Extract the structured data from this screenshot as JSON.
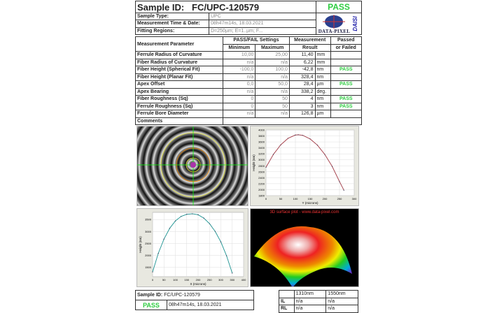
{
  "header": {
    "sample_id_label": "Sample ID:",
    "sample_id": "FC/UPC-120579",
    "status": "PASS",
    "rows": [
      {
        "label": "Sample Type:",
        "value": "UPC"
      },
      {
        "label": "Measurement Time & Date:",
        "value": "08h47m14s, 18.03.2021"
      },
      {
        "label": "Fitting Regions:",
        "value": "D=250µm; E=1..µm; F..."
      }
    ],
    "logo_text": "DATA-PIXEL",
    "logo_brand": "DAISI"
  },
  "table": {
    "col_param": "Measurement Parameter",
    "col_settings": "PASS/FAIL Settings",
    "col_min": "Minimum",
    "col_max": "Maximum",
    "col_result": "Measurement",
    "col_result2": "Result",
    "col_pf": "Passed",
    "col_pf2": "or Failed",
    "rows": [
      {
        "name": "Ferrule Radius of Curvature",
        "min": "10,00",
        "max": "25,00",
        "value": "11,40",
        "unit": "mm",
        "status": ""
      },
      {
        "name": "Fiber Radius of Curvature",
        "min": "n/a",
        "max": "n/a",
        "value": "6,22",
        "unit": "mm",
        "status": ""
      },
      {
        "name": "Fiber Height (Spherical Fit)",
        "min": "-100,0",
        "max": "100,0",
        "value": "-42,8",
        "unit": "nm",
        "status": "PASS"
      },
      {
        "name": "Fiber Height (Planar Fit)",
        "min": "n/a",
        "max": "n/a",
        "value": "328,4",
        "unit": "nm",
        "status": ""
      },
      {
        "name": "Apex Offset",
        "min": "0,0",
        "max": "50,0",
        "value": "28,4",
        "unit": "µm",
        "status": "PASS"
      },
      {
        "name": "Apex Bearing",
        "min": "n/a",
        "max": "n/a",
        "value": "338,2",
        "unit": "deg.",
        "status": ""
      },
      {
        "name": "Fiber Roughness (Sq)",
        "min": "0",
        "max": "50",
        "value": "4",
        "unit": "nm",
        "status": "PASS"
      },
      {
        "name": "Ferrule Roughness (Sq)",
        "min": "0",
        "max": "50",
        "value": "3",
        "unit": "nm",
        "status": "PASS"
      },
      {
        "name": "Ferrule Bore Diameter",
        "min": "n/a",
        "max": "n/a",
        "value": "126,8",
        "unit": "µm",
        "status": ""
      }
    ],
    "comments_label": "Comments",
    "comments": ""
  },
  "plot3d_title": "3D surface plot - www.data-pixel.com",
  "chart_data": [
    {
      "type": "line",
      "xlabel": "Y (microns)",
      "ylabel": "Height (nm)",
      "xlim": [
        0,
        300
      ],
      "ylim": [
        1800,
        4000
      ],
      "xticks": [
        0,
        50,
        100,
        150,
        200,
        250,
        300
      ],
      "yticks": [
        1800,
        2000,
        2200,
        2400,
        2600,
        2800,
        3000,
        3200,
        3400,
        3600,
        3800,
        4000
      ],
      "grid": true,
      "x": [
        0,
        25,
        50,
        75,
        100,
        110,
        125,
        150,
        175,
        200,
        225,
        250,
        265
      ],
      "y": [
        2750,
        3180,
        3500,
        3720,
        3830,
        3840,
        3820,
        3700,
        3490,
        3180,
        2780,
        2270,
        1980
      ]
    },
    {
      "type": "line",
      "xlabel": "X (microns)",
      "ylabel": "Height (nm)",
      "xlim": [
        0,
        400
      ],
      "ylim": [
        1100,
        3800
      ],
      "xticks": [
        0,
        50,
        100,
        150,
        200,
        250,
        300,
        350,
        400
      ],
      "yticks": [
        1500,
        2000,
        2500,
        3000,
        3500
      ],
      "grid": true,
      "x": [
        0,
        25,
        50,
        75,
        100,
        125,
        150,
        175,
        200,
        225,
        250,
        275,
        300,
        325,
        350
      ],
      "y": [
        1300,
        2080,
        2680,
        3130,
        3440,
        3630,
        3720,
        3740,
        3700,
        3560,
        3330,
        3000,
        2560,
        1980,
        1250
      ]
    }
  ],
  "footer": {
    "sample_id_label": "Sample ID:",
    "sample_id": "FC/UPC-120579",
    "status": "PASS",
    "datetime": "08h47m14s, 18.03.2021",
    "loss": {
      "col1": "1310nm",
      "col2": "1550nm",
      "rows": [
        {
          "label": "IL",
          "v1": "n/a",
          "v2": "n/a"
        },
        {
          "label": "RL",
          "v1": "n/a",
          "v2": "n/a"
        }
      ]
    }
  }
}
